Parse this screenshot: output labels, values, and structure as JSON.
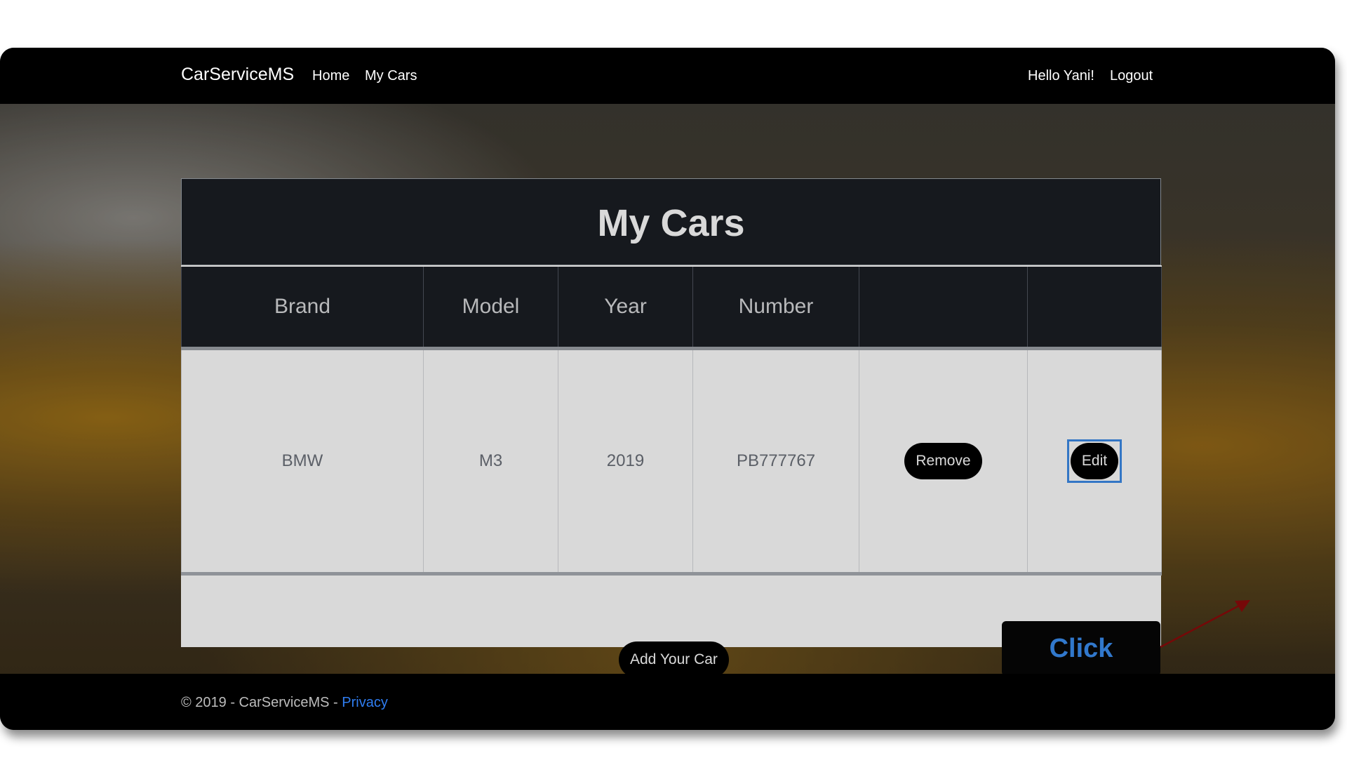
{
  "navbar": {
    "brand": "CarServiceMS",
    "links": [
      "Home",
      "My Cars"
    ],
    "greeting": "Hello Yani!",
    "logout": "Logout"
  },
  "card": {
    "title": "My Cars",
    "columns": [
      "Brand",
      "Model",
      "Year",
      "Number",
      "",
      ""
    ],
    "rows": [
      {
        "brand": "BMW",
        "model": "M3",
        "year": "2019",
        "number": "PB777767",
        "remove_label": "Remove",
        "edit_label": "Edit"
      }
    ],
    "add_label": "Add Your Car"
  },
  "annotation": {
    "callout_text": "Click",
    "callout_text_color": "#3a8ef0",
    "arrow_color": "#8b0a0a",
    "highlight_color": "#3d8be8"
  },
  "footer": {
    "copyright": "© 2019 - CarServiceMS - ",
    "privacy": "Privacy",
    "link_color": "#2f7df0"
  }
}
